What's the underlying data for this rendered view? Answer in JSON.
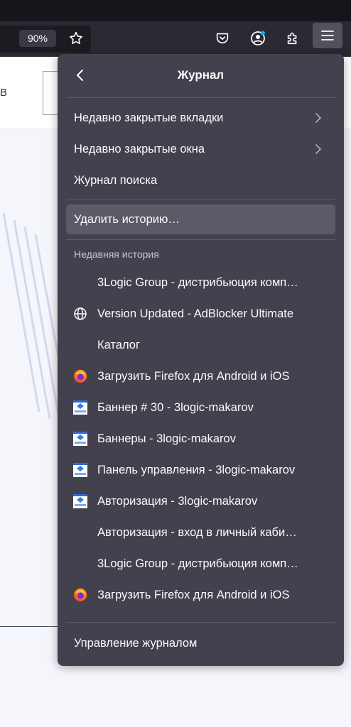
{
  "toolbar": {
    "zoom": "90%"
  },
  "page": {
    "header_letter": "В"
  },
  "panel": {
    "title": "Журнал",
    "items": [
      {
        "label": "Недавно закрытые вкладки"
      },
      {
        "label": "Недавно закрытые окна"
      },
      {
        "label": "Журнал поиска"
      }
    ],
    "clear_history": "Удалить историю…",
    "recent_label": "Недавняя история",
    "history": [
      {
        "label": "3Logic Group - дистрибьюция комп…",
        "icon": "none"
      },
      {
        "label": "Version Updated - AdBlocker Ultimate",
        "icon": "globe-icon"
      },
      {
        "label": "Каталог",
        "icon": "none"
      },
      {
        "label": "Загрузить Firefox для Android и iOS",
        "icon": "firefox-icon"
      },
      {
        "label": "Баннер # 30 - 3logic-makarov",
        "icon": "site-favicon"
      },
      {
        "label": "Баннеры - 3logic-makarov",
        "icon": "site-favicon"
      },
      {
        "label": "Панель управления - 3logic-makarov",
        "icon": "site-favicon"
      },
      {
        "label": "Авторизация - 3logic-makarov",
        "icon": "site-favicon"
      },
      {
        "label": "Авторизация - вход в личный каби…",
        "icon": "none"
      },
      {
        "label": "3Logic Group - дистрибьюция комп…",
        "icon": "none"
      },
      {
        "label": "Загрузить Firefox для Android и iOS",
        "icon": "firefox-icon"
      }
    ],
    "manage": "Управление журналом"
  },
  "colors": {
    "panel_bg": "#42414d",
    "toolbar_bg": "#2b2a33",
    "text": "#fbfbfe",
    "accent_badge": "#00b3f4"
  }
}
